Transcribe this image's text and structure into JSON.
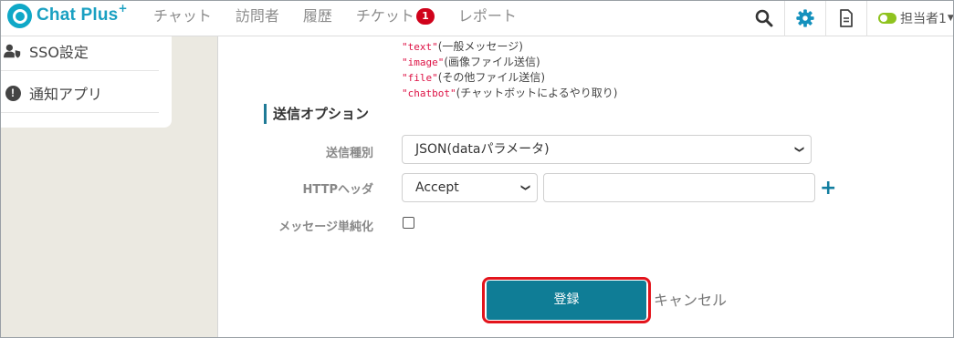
{
  "app": {
    "logo_text": "Chat Plus",
    "logo_plus": "+"
  },
  "nav": {
    "items": [
      {
        "label": "チャット"
      },
      {
        "label": "訪問者"
      },
      {
        "label": "履歴"
      },
      {
        "label": "チケット",
        "badge": "1"
      },
      {
        "label": "レポート"
      }
    ]
  },
  "toolbar": {
    "search_icon": "search-icon",
    "settings_icon": "gear-icon",
    "document_icon": "document-icon",
    "user_label": "担当者1",
    "user_status_color": "#8fc31f"
  },
  "sidebar": {
    "items": [
      {
        "label": "SSO設定",
        "icon": "user-shield-icon"
      },
      {
        "label": "通知アプリ",
        "icon": "exclamation-circle-icon"
      }
    ]
  },
  "main": {
    "message_types": [
      {
        "code": "\"text\"",
        "desc": "(一般メッセージ)"
      },
      {
        "code": "\"image\"",
        "desc": "(画像ファイル送信)"
      },
      {
        "code": "\"file\"",
        "desc": "(その他ファイル送信)"
      },
      {
        "code": "\"chatbot\"",
        "desc": "(チャットボットによるやり取り)"
      }
    ],
    "section_title": "送信オプション",
    "send_type": {
      "label": "送信種別",
      "value": "JSON(dataパラメータ)"
    },
    "http_header": {
      "label": "HTTPヘッダ",
      "select_value": "Accept",
      "input_value": "",
      "add_symbol": "+"
    },
    "simplify": {
      "label": "メッセージ単純化",
      "checked": false
    },
    "submit_label": "登録",
    "cancel_label": "キャンセル"
  },
  "colors": {
    "accent": "#0f7d96",
    "highlight": "#e3141c",
    "badge": "#d0021b",
    "brand": "#1aa0c2"
  }
}
